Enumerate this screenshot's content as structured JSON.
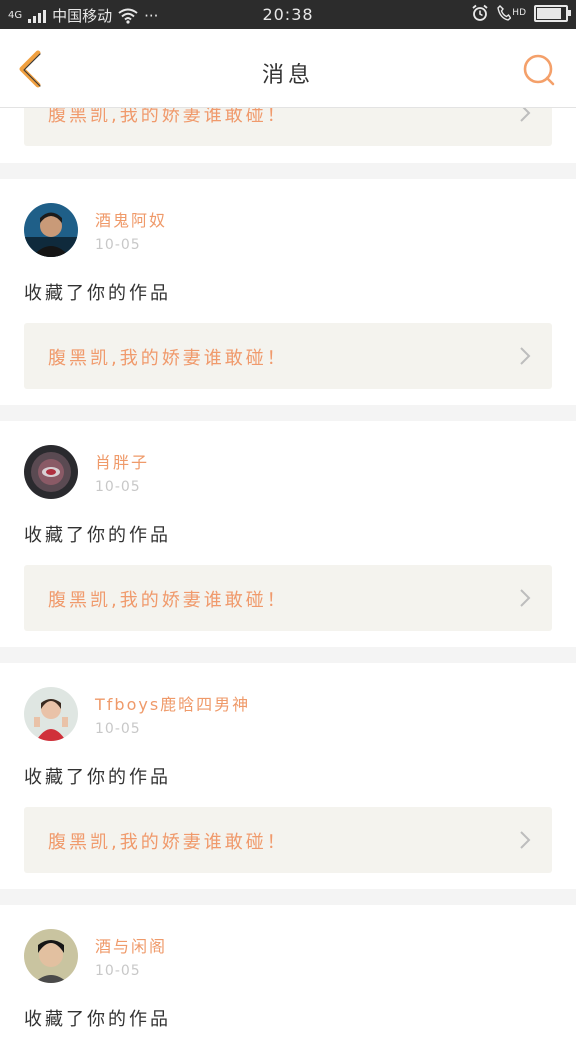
{
  "status_bar": {
    "network": "4G",
    "carrier": "中国移动",
    "more": "···",
    "time": "20:38",
    "hd": "HD"
  },
  "header": {
    "title": "消息"
  },
  "colors": {
    "accent": "#f0a040",
    "username": "#ef9a6a",
    "work_title": "#f09a6c",
    "date": "#c8c8c8"
  },
  "partial_item": {
    "work_title": "腹黑凯,我的娇妻谁敢碰！"
  },
  "messages": [
    {
      "username": "酒鬼阿奴",
      "date": "10-05",
      "action": "收藏了你的作品",
      "work_title": "腹黑凯,我的娇妻谁敢碰！"
    },
    {
      "username": "肖胖子",
      "date": "10-05",
      "action": "收藏了你的作品",
      "work_title": "腹黑凯,我的娇妻谁敢碰！"
    },
    {
      "username": "Tfboys鹿晗四男神",
      "date": "10-05",
      "action": "收藏了你的作品",
      "work_title": "腹黑凯,我的娇妻谁敢碰！"
    },
    {
      "username": "酒与闲阁",
      "date": "10-05",
      "action": "收藏了你的作品",
      "work_title": ""
    }
  ]
}
